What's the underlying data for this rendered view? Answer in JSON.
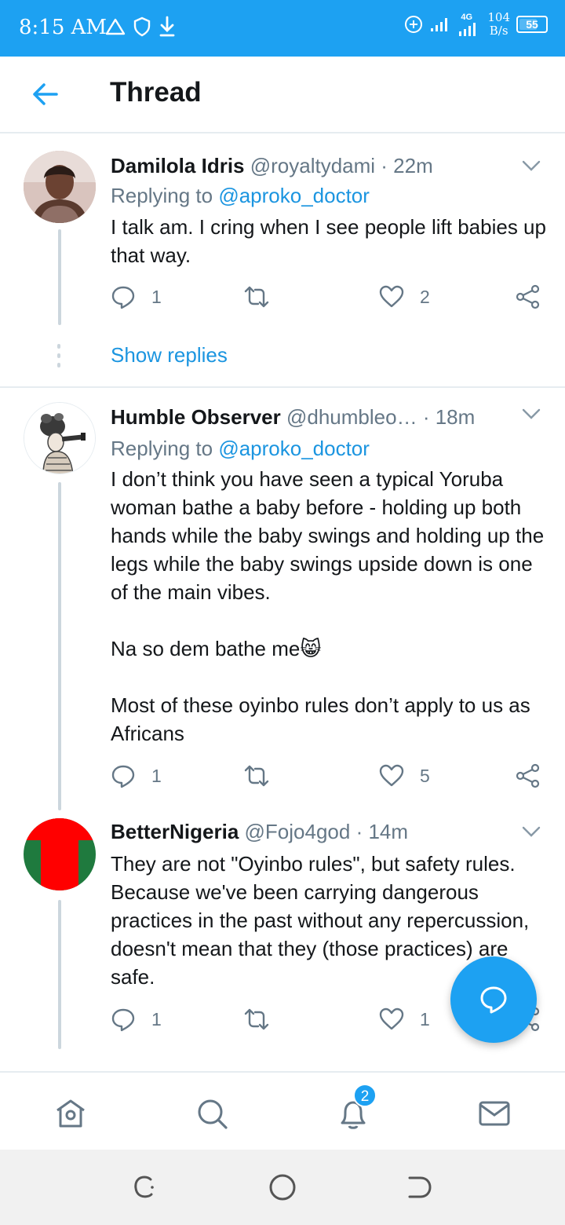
{
  "status_bar": {
    "time": "8:15 AM",
    "network": "4G",
    "speed_value": "104",
    "speed_unit": "B/s",
    "battery": "55"
  },
  "header": {
    "title": "Thread"
  },
  "tweets": [
    {
      "name": "Damilola Idris",
      "handle": "@royaltydami",
      "time": "· 22m",
      "replying_prefix": "Replying to ",
      "replying_to": "@aproko_doctor",
      "body": "I talk am. I cring when I see people lift babies up that way.",
      "replies": "1",
      "likes": "2",
      "show_replies": "Show replies"
    },
    {
      "name": "Humble Observer",
      "handle": "@dhumbleo…",
      "time": "· 18m",
      "replying_prefix": "Replying to ",
      "replying_to": "@aproko_doctor",
      "body": "I don’t think you have seen a typical Yoruba woman bathe a baby before - holding up both hands while the baby swings and holding up the legs while the baby swings upside down is one of the main vibes.\n\nNa so dem bathe me😸\n\nMost of these oyinbo rules don’t apply to us as Africans",
      "replies": "1",
      "likes": "5"
    },
    {
      "name": "BetterNigeria",
      "handle": "@Fojo4god",
      "time": "· 14m",
      "body": "They are not \"Oyinbo rules\", but safety rules. Because we've been carrying dangerous practices in the past without any repercussion, doesn't mean that they (those practices) are safe.",
      "replies": "1",
      "likes": "1"
    }
  ],
  "bottom_nav": {
    "notifications_badge": "2",
    "items": [
      "home-icon",
      "search-icon",
      "notifications-icon",
      "messages-icon"
    ]
  },
  "colors": {
    "accent": "#1da1f2",
    "link": "#1b95e0",
    "muted": "#657786",
    "text": "#14171a"
  }
}
